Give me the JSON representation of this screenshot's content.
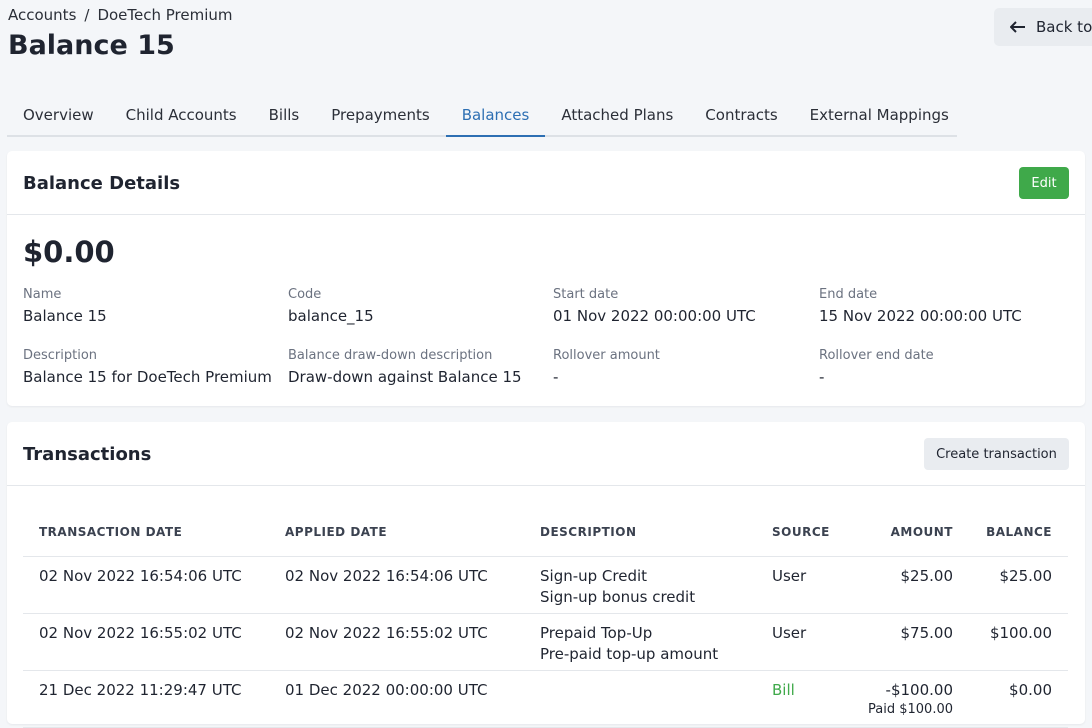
{
  "breadcrumb": {
    "parent": "Accounts",
    "separator": "/",
    "current": "DoeTech Premium"
  },
  "page": {
    "title": "Balance 15"
  },
  "back_button": {
    "label": "Back to"
  },
  "tabs": [
    {
      "label": "Overview"
    },
    {
      "label": "Child Accounts"
    },
    {
      "label": "Bills"
    },
    {
      "label": "Prepayments"
    },
    {
      "label": "Balances",
      "active": true
    },
    {
      "label": "Attached Plans"
    },
    {
      "label": "Contracts"
    },
    {
      "label": "External Mappings"
    }
  ],
  "balance_details": {
    "title": "Balance Details",
    "edit_label": "Edit",
    "amount": "$0.00",
    "fields": {
      "name": {
        "label": "Name",
        "value": "Balance 15"
      },
      "code": {
        "label": "Code",
        "value": "balance_15"
      },
      "start_date": {
        "label": "Start date",
        "value": "01 Nov 2022 00:00:00 UTC"
      },
      "end_date": {
        "label": "End date",
        "value": "15 Nov 2022 00:00:00 UTC"
      },
      "description": {
        "label": "Description",
        "value": "Balance 15 for DoeTech Premium"
      },
      "drawdown": {
        "label": "Balance draw-down description",
        "value": "Draw-down against Balance 15"
      },
      "rollover_amount": {
        "label": "Rollover amount",
        "value": "-"
      },
      "rollover_end": {
        "label": "Rollover end date",
        "value": "-"
      }
    }
  },
  "transactions": {
    "title": "Transactions",
    "create_label": "Create transaction",
    "columns": [
      "TRANSACTION DATE",
      "APPLIED DATE",
      "DESCRIPTION",
      "SOURCE",
      "AMOUNT",
      "BALANCE"
    ],
    "rows": [
      {
        "transaction_date": "02 Nov 2022 16:54:06 UTC",
        "applied_date": "02 Nov 2022 16:54:06 UTC",
        "description": "Sign-up Credit",
        "description_sub": "Sign-up bonus credit",
        "source": "User",
        "amount": "$25.00",
        "amount_sub": "",
        "balance": "$25.00"
      },
      {
        "transaction_date": "02 Nov 2022 16:55:02 UTC",
        "applied_date": "02 Nov 2022 16:55:02 UTC",
        "description": "Prepaid Top-Up",
        "description_sub": "Pre-paid top-up amount",
        "source": "User",
        "amount": "$75.00",
        "amount_sub": "",
        "balance": "$100.00"
      },
      {
        "transaction_date": "21 Dec 2022 11:29:47 UTC",
        "applied_date": "01 Dec 2022 00:00:00 UTC",
        "description": "",
        "description_sub": "",
        "source": "Bill",
        "amount": "-$100.00",
        "amount_sub": "Paid $100.00",
        "balance": "$0.00"
      }
    ]
  },
  "colors": {
    "accent": "#2d6fb3",
    "success": "#3fa94a",
    "background": "#f4f6f9"
  },
  "icons": {
    "back": "arrow-left-icon"
  }
}
